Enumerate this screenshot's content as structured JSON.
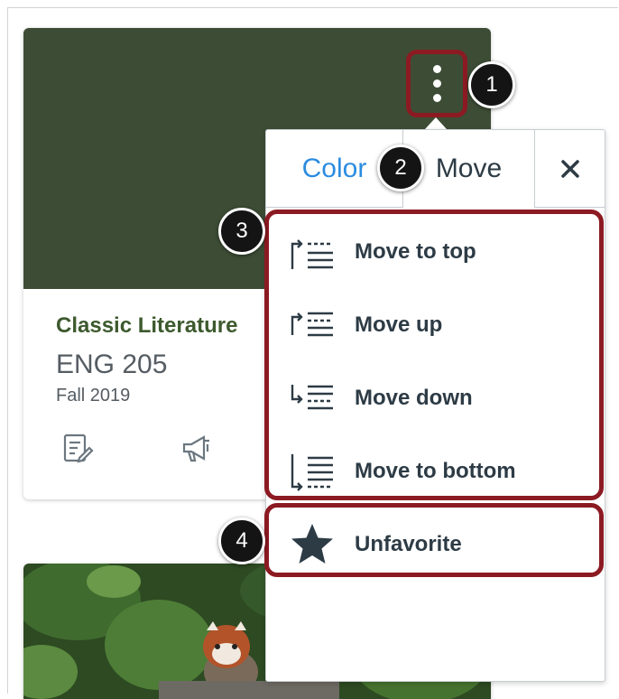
{
  "course_card": {
    "name": "Classic Literature",
    "code": "ENG 205",
    "term": "Fall 2019",
    "hero_color": "#3d4d35",
    "name_color": "#3d5a2e",
    "icons": [
      "assignments-icon",
      "announcements-icon"
    ]
  },
  "popover": {
    "tabs": {
      "color_label": "Color",
      "move_label": "Move"
    },
    "color_tab_color": "#2b8ce0",
    "close_icon": "close-icon",
    "menu_items": [
      {
        "label": "Move to top",
        "icon": "move-to-top-icon"
      },
      {
        "label": "Move up",
        "icon": "move-up-icon"
      },
      {
        "label": "Move down",
        "icon": "move-down-icon"
      },
      {
        "label": "Move to bottom",
        "icon": "move-to-bottom-icon"
      }
    ],
    "favorite_item": {
      "label": "Unfavorite",
      "icon": "star-icon"
    }
  },
  "callouts": [
    "1",
    "2",
    "3",
    "4"
  ],
  "accent_color": "#8c1a22"
}
